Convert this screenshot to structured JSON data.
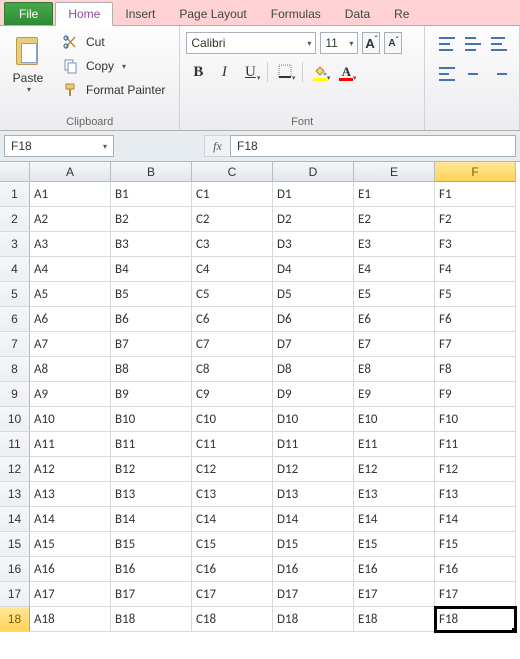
{
  "tabs": {
    "file": "File",
    "home": "Home",
    "insert": "Insert",
    "pagelayout": "Page Layout",
    "formulas": "Formulas",
    "data": "Data",
    "review_partial": "Re"
  },
  "ribbon": {
    "clipboard": {
      "title": "Clipboard",
      "paste": "Paste",
      "cut": "Cut",
      "copy": "Copy",
      "format_painter": "Format Painter"
    },
    "font": {
      "title": "Font",
      "name": "Calibri",
      "size": "11",
      "bold": "B",
      "italic": "I",
      "underline": "U",
      "font_color_letter": "A",
      "fill_color_hex": "#ffff00",
      "font_color_hex": "#ff0000",
      "grow_label": "A",
      "shrink_label": "A"
    },
    "alignment": {
      "title": ""
    }
  },
  "fbar": {
    "namebox": "F18",
    "fx": "fx",
    "formula": "F18"
  },
  "grid": {
    "cols": [
      "A",
      "B",
      "C",
      "D",
      "E",
      "F"
    ],
    "row_count": 18,
    "selected_col": "F",
    "selected_row": 18,
    "data": [
      [
        "A1",
        "B1",
        "C1",
        "D1",
        "E1",
        "F1"
      ],
      [
        "A2",
        "B2",
        "C2",
        "D2",
        "E2",
        "F2"
      ],
      [
        "A3",
        "B3",
        "C3",
        "D3",
        "E3",
        "F3"
      ],
      [
        "A4",
        "B4",
        "C4",
        "D4",
        "E4",
        "F4"
      ],
      [
        "A5",
        "B5",
        "C5",
        "D5",
        "E5",
        "F5"
      ],
      [
        "A6",
        "B6",
        "C6",
        "D6",
        "E6",
        "F6"
      ],
      [
        "A7",
        "B7",
        "C7",
        "D7",
        "E7",
        "F7"
      ],
      [
        "A8",
        "B8",
        "C8",
        "D8",
        "E8",
        "F8"
      ],
      [
        "A9",
        "B9",
        "C9",
        "D9",
        "E9",
        "F9"
      ],
      [
        "A10",
        "B10",
        "C10",
        "D10",
        "E10",
        "F10"
      ],
      [
        "A11",
        "B11",
        "C11",
        "D11",
        "E11",
        "F11"
      ],
      [
        "A12",
        "B12",
        "C12",
        "D12",
        "E12",
        "F12"
      ],
      [
        "A13",
        "B13",
        "C13",
        "D13",
        "E13",
        "F13"
      ],
      [
        "A14",
        "B14",
        "C14",
        "D14",
        "E14",
        "F14"
      ],
      [
        "A15",
        "B15",
        "C15",
        "D15",
        "E15",
        "F15"
      ],
      [
        "A16",
        "B16",
        "C16",
        "D16",
        "E16",
        "F16"
      ],
      [
        "A17",
        "B17",
        "C17",
        "D17",
        "E17",
        "F17"
      ],
      [
        "A18",
        "B18",
        "C18",
        "D18",
        "E18",
        "F18"
      ]
    ]
  }
}
